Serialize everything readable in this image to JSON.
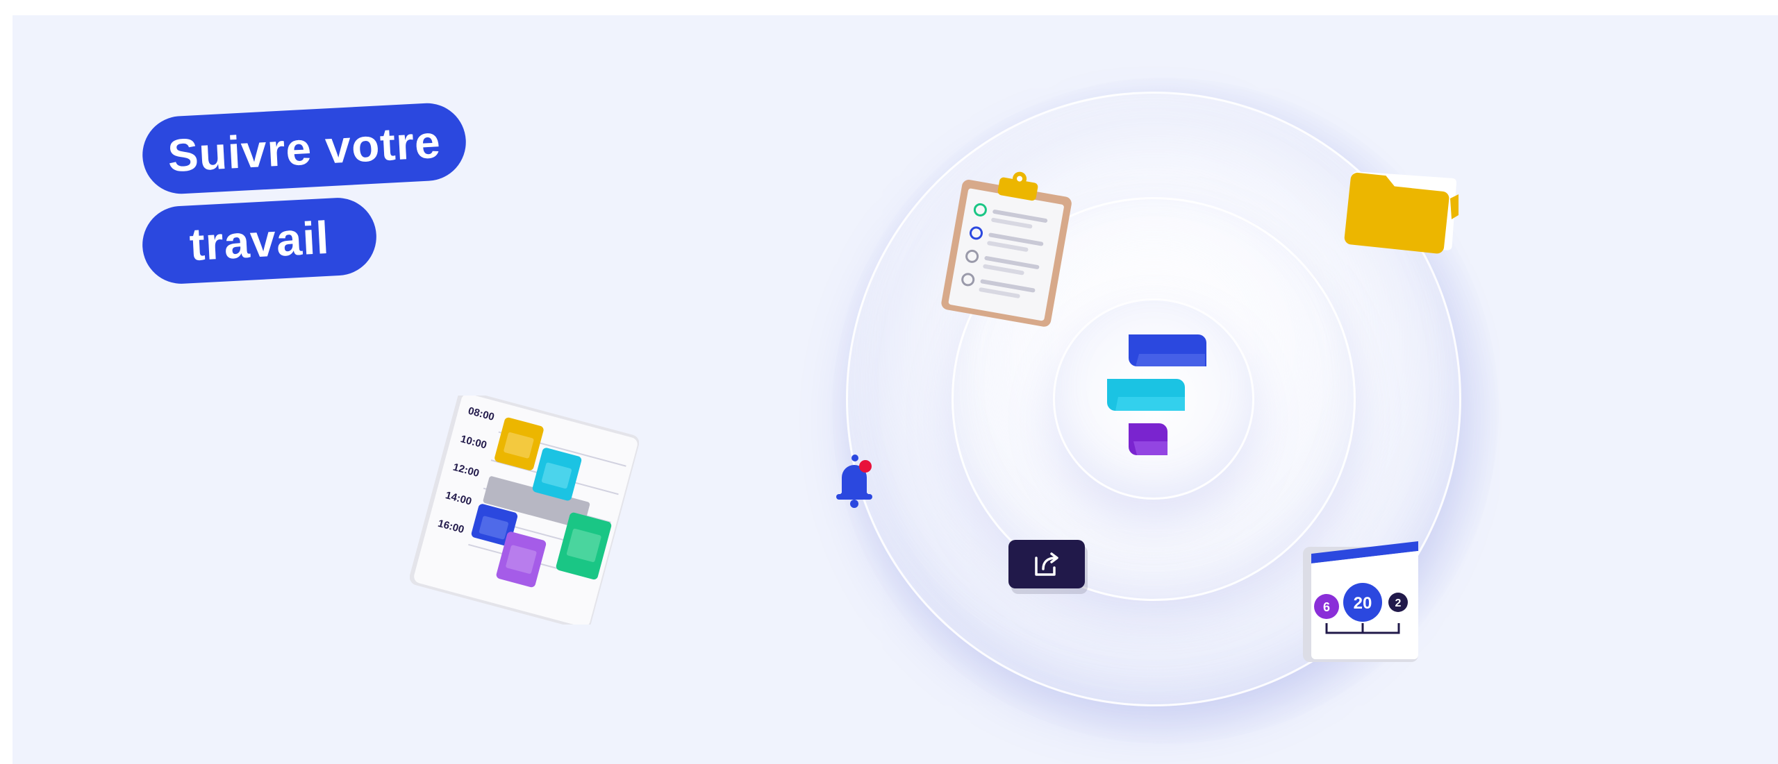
{
  "headline": {
    "line1": "Suivre votre",
    "line2": "travail"
  },
  "calendar": {
    "times": [
      "08:00",
      "10:00",
      "12:00",
      "14:00",
      "16:00"
    ]
  },
  "stats": {
    "left_badge": "6",
    "center_badge": "20",
    "right_badge": "2"
  },
  "icons": {
    "logo": "brand-logo-icon",
    "clipboard": "checklist-clipboard-icon",
    "folder": "folder-icon",
    "calendar": "calendar-schedule-icon",
    "bell": "notification-bell-icon",
    "share": "share-icon",
    "stats": "stats-window-icon"
  },
  "colors": {
    "background": "#f0f3fd",
    "primary_blue": "#2b48df",
    "cyan": "#1bc3e3",
    "purple": "#8a2ed8",
    "yellow": "#ecb600",
    "green": "#1ac685",
    "navy": "#21194a",
    "red_dot": "#e8113a"
  }
}
